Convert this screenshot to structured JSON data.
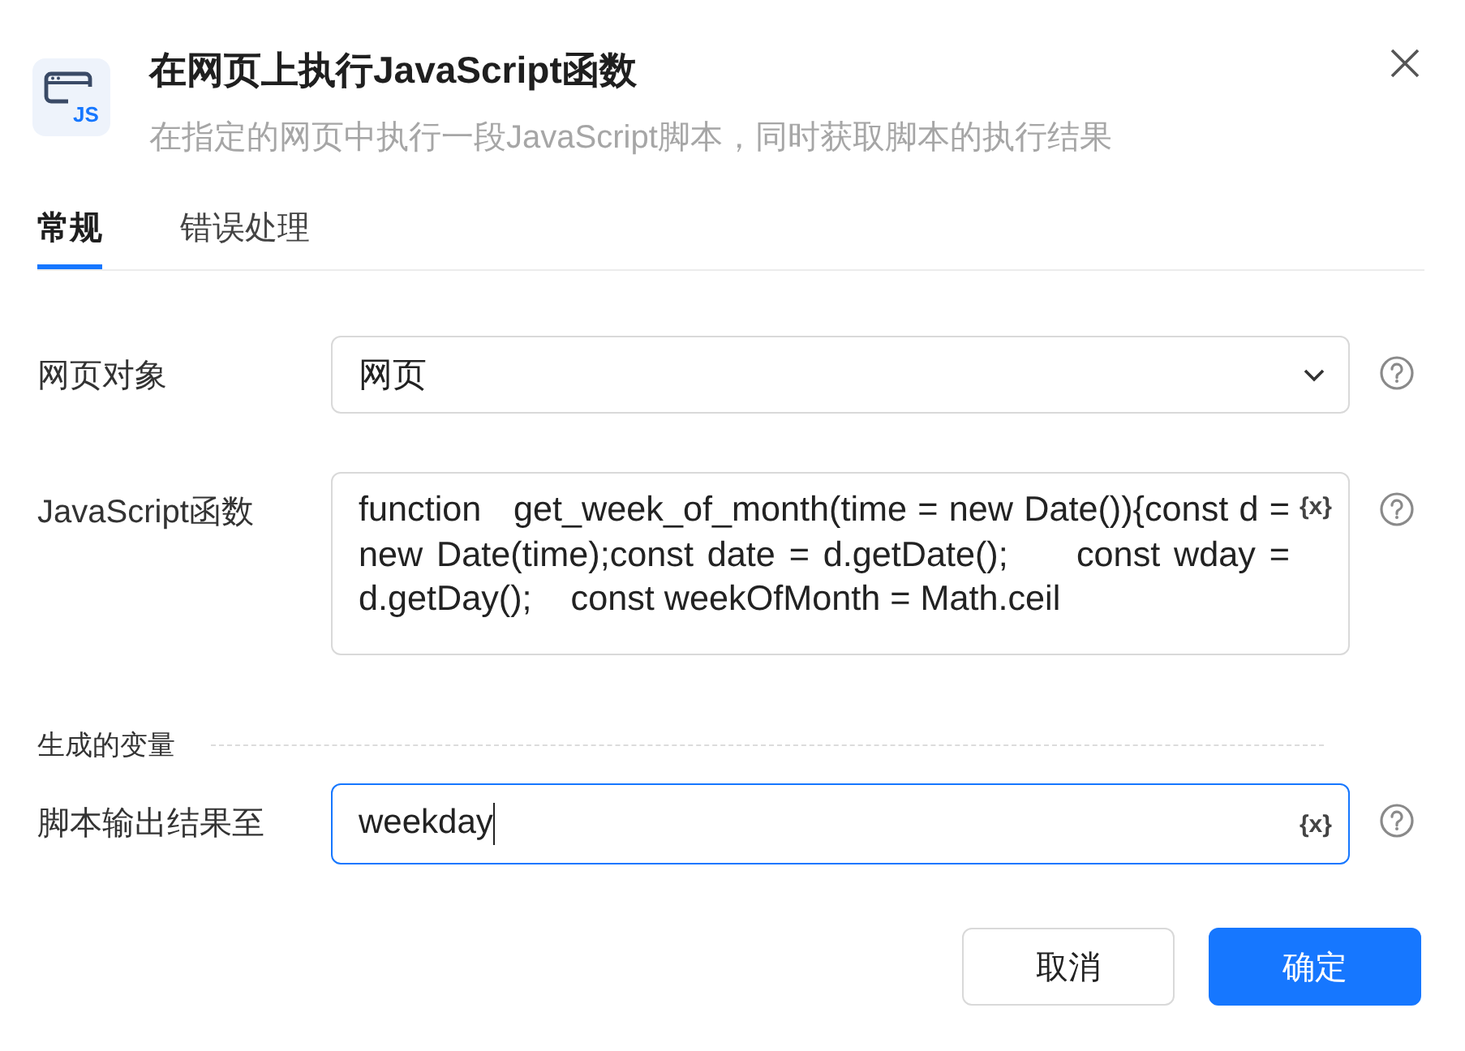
{
  "dialog": {
    "icon_label": "JS",
    "title": "在网页上执行JavaScript函数",
    "subtitle": "在指定的网页中执行一段JavaScript脚本，同时获取脚本的执行结果"
  },
  "tabs": [
    {
      "label": "常规",
      "selected": true
    },
    {
      "label": "错误处理",
      "selected": false
    }
  ],
  "fields": [
    {
      "kind": "select",
      "label": "网页对象",
      "value": "网页"
    },
    {
      "kind": "code",
      "label": "JavaScript函数",
      "value": "function   get_week_of_month(time = new Date()){const d = new Date(time);const date = d.getDate();     const wday = d.getDay();    const weekOfMonth = Math.ceil",
      "insert_symbol": "{x}"
    }
  ],
  "section": "生成的变量",
  "outputs": [
    {
      "kind": "text",
      "label": "脚本输出结果至",
      "value": "weekday",
      "focused": true,
      "insert_symbol": "{x}"
    }
  ],
  "buttons": [
    {
      "label": "取消",
      "kind": "secondary"
    },
    {
      "label": "确定",
      "kind": "primary"
    }
  ]
}
